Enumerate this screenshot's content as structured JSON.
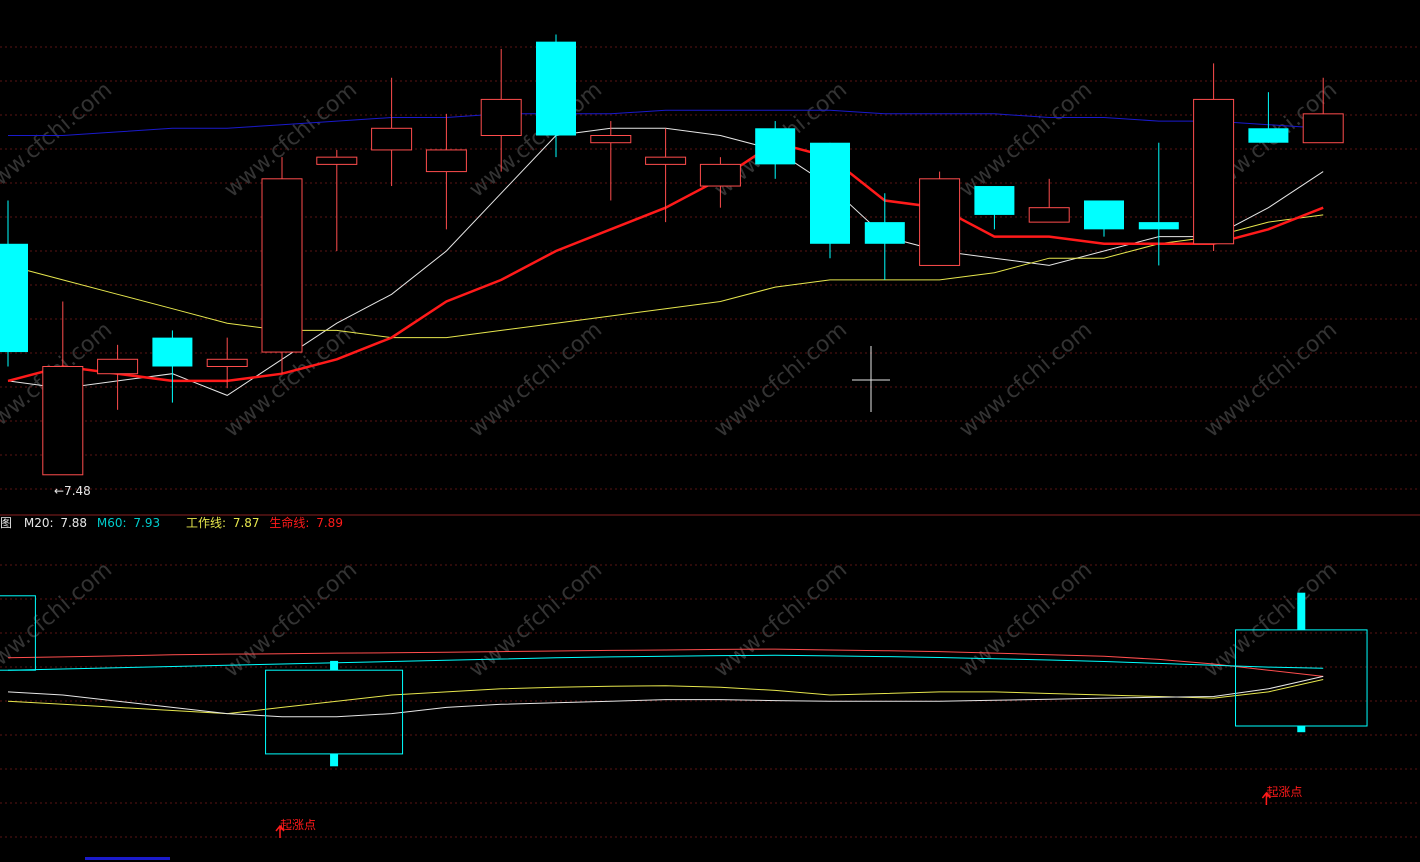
{
  "colors": {
    "background": "#000000",
    "up_candle": "#ff4d4d",
    "down_candle": "#00ffff",
    "ma_white": "#e6e6e6",
    "ma_yellow": "#e6e64d",
    "ma_blue": "#1a1acc",
    "life_line": "#ff1a1a",
    "grid": "#5a1414",
    "watermark": "#333333"
  },
  "watermark": "www.cfchi.com",
  "legend": {
    "prefix": "图",
    "m20_label": "M20:",
    "m20_value": "7.88",
    "m60_label": "M60:",
    "m60_value": "7.93",
    "work_label": "工作线:",
    "work_value": "7.87",
    "life_label": "生命线:",
    "life_value": "7.89"
  },
  "low_marker": "←7.48",
  "chart_data": [
    {
      "type": "candlestick",
      "title": "",
      "y_range": [
        7.47,
        8.11
      ],
      "candles": [
        {
          "o": 7.8,
          "h": 7.86,
          "l": 7.63,
          "c": 7.65,
          "dir": "down"
        },
        {
          "o": 7.63,
          "h": 7.72,
          "l": 7.48,
          "c": 7.48,
          "dir": "up"
        },
        {
          "o": 7.62,
          "h": 7.66,
          "l": 7.57,
          "c": 7.64,
          "dir": "up"
        },
        {
          "o": 7.67,
          "h": 7.68,
          "l": 7.58,
          "c": 7.63,
          "dir": "down"
        },
        {
          "o": 7.63,
          "h": 7.67,
          "l": 7.6,
          "c": 7.64,
          "dir": "up"
        },
        {
          "o": 7.65,
          "h": 7.92,
          "l": 7.62,
          "c": 7.89,
          "dir": "up"
        },
        {
          "o": 7.91,
          "h": 7.93,
          "l": 7.79,
          "c": 7.92,
          "dir": "up"
        },
        {
          "o": 7.93,
          "h": 8.03,
          "l": 7.88,
          "c": 7.96,
          "dir": "up"
        },
        {
          "o": 7.9,
          "h": 7.98,
          "l": 7.82,
          "c": 7.93,
          "dir": "up"
        },
        {
          "o": 7.95,
          "h": 8.07,
          "l": 7.9,
          "c": 8.0,
          "dir": "up"
        },
        {
          "o": 8.08,
          "h": 8.09,
          "l": 7.92,
          "c": 7.95,
          "dir": "down"
        },
        {
          "o": 7.94,
          "h": 7.97,
          "l": 7.86,
          "c": 7.95,
          "dir": "up"
        },
        {
          "o": 7.91,
          "h": 7.96,
          "l": 7.83,
          "c": 7.92,
          "dir": "up"
        },
        {
          "o": 7.88,
          "h": 7.92,
          "l": 7.85,
          "c": 7.91,
          "dir": "up"
        },
        {
          "o": 7.96,
          "h": 7.97,
          "l": 7.89,
          "c": 7.91,
          "dir": "down"
        },
        {
          "o": 7.94,
          "h": 7.94,
          "l": 7.78,
          "c": 7.8,
          "dir": "down"
        },
        {
          "o": 7.83,
          "h": 7.87,
          "l": 7.75,
          "c": 7.8,
          "dir": "down"
        },
        {
          "o": 7.77,
          "h": 7.9,
          "l": 7.77,
          "c": 7.89,
          "dir": "up"
        },
        {
          "o": 7.88,
          "h": 7.88,
          "l": 7.82,
          "c": 7.84,
          "dir": "down"
        },
        {
          "o": 7.83,
          "h": 7.89,
          "l": 7.83,
          "c": 7.85,
          "dir": "up"
        },
        {
          "o": 7.86,
          "h": 7.86,
          "l": 7.81,
          "c": 7.82,
          "dir": "down"
        },
        {
          "o": 7.83,
          "h": 7.94,
          "l": 7.77,
          "c": 7.82,
          "dir": "down"
        },
        {
          "o": 7.8,
          "h": 8.05,
          "l": 7.79,
          "c": 8.0,
          "dir": "up"
        },
        {
          "o": 7.96,
          "h": 8.01,
          "l": 7.94,
          "c": 7.94,
          "dir": "down"
        },
        {
          "o": 7.94,
          "h": 8.03,
          "l": 7.94,
          "c": 7.98,
          "dir": "up"
        }
      ],
      "series": [
        {
          "color_key": "ma_white",
          "values": [
            7.61,
            7.6,
            7.61,
            7.62,
            7.59,
            7.64,
            7.69,
            7.73,
            7.79,
            7.87,
            7.95,
            7.96,
            7.96,
            7.95,
            7.93,
            7.88,
            7.81,
            7.79,
            7.78,
            7.77,
            7.79,
            7.81,
            7.81,
            7.85,
            7.9
          ]
        },
        {
          "color_key": "ma_yellow",
          "values": [
            7.77,
            7.75,
            7.73,
            7.71,
            7.69,
            7.68,
            7.68,
            7.67,
            7.67,
            7.68,
            7.69,
            7.7,
            7.71,
            7.72,
            7.74,
            7.75,
            7.75,
            7.75,
            7.76,
            7.78,
            7.78,
            7.8,
            7.81,
            7.83,
            7.84
          ]
        },
        {
          "color_key": "ma_blue",
          "values": [
            7.95,
            7.95,
            7.955,
            7.96,
            7.96,
            7.965,
            7.97,
            7.975,
            7.975,
            7.98,
            7.98,
            7.98,
            7.985,
            7.985,
            7.985,
            7.985,
            7.98,
            7.98,
            7.98,
            7.975,
            7.975,
            7.97,
            7.97,
            7.965,
            7.96
          ]
        },
        {
          "color_key": "life_line",
          "values": [
            7.61,
            7.63,
            7.62,
            7.61,
            7.61,
            7.62,
            7.64,
            7.67,
            7.72,
            7.75,
            7.79,
            7.82,
            7.85,
            7.89,
            7.94,
            7.92,
            7.86,
            7.85,
            7.81,
            7.81,
            7.8,
            7.8,
            7.8,
            7.82,
            7.85
          ]
        }
      ]
    },
    {
      "type": "indicator",
      "title": "",
      "y_range": [
        0,
        100
      ],
      "boxes": [
        {
          "start": -0.5,
          "end": 0.5,
          "top": 82,
          "bottom": 58
        },
        {
          "start": 4.7,
          "end": 7.2,
          "top": 58,
          "bottom": 31,
          "stick_top": 61,
          "stick_bottom": 27
        },
        {
          "start": 22.4,
          "end": 24.8,
          "top": 71,
          "bottom": 40,
          "stick_top": 83,
          "stick_bottom": 38
        }
      ],
      "series": [
        {
          "color_key": "up_candle",
          "values": [
            62,
            62.3,
            62.6,
            63,
            63.2,
            63.3,
            63.5,
            63.6,
            63.8,
            64,
            64.2,
            64.4,
            64.5,
            64.7,
            64.8,
            64.5,
            64.3,
            64,
            63.5,
            63,
            62.5,
            61.5,
            60,
            58,
            56
          ]
        },
        {
          "color_key": "down_candle",
          "values": [
            58,
            58.4,
            58.8,
            59.2,
            59.6,
            60,
            60.4,
            60.8,
            61.2,
            61.6,
            62,
            62.3,
            62.5,
            62.7,
            62.8,
            62.6,
            62.4,
            62.1,
            61.7,
            61.3,
            60.8,
            60.2,
            59.6,
            59,
            58.6
          ]
        },
        {
          "color_key": "ma_yellow",
          "values": [
            48,
            47,
            46,
            45,
            44,
            46,
            48,
            50,
            51,
            52,
            52.5,
            52.8,
            53,
            52.5,
            51.5,
            50,
            50.5,
            51,
            51,
            50.5,
            50,
            49.5,
            49,
            51,
            55
          ]
        },
        {
          "color_key": "ma_white",
          "values": [
            51,
            50,
            48,
            46,
            44,
            43,
            43,
            44,
            46,
            47,
            47.5,
            48,
            48.5,
            48.5,
            48.2,
            48,
            48,
            48,
            48.3,
            48.6,
            49,
            49.3,
            49.5,
            52,
            56
          ]
        }
      ],
      "signals": [
        {
          "index": 5,
          "label": "起涨点"
        },
        {
          "index": 23,
          "label": "起涨点"
        }
      ]
    }
  ]
}
